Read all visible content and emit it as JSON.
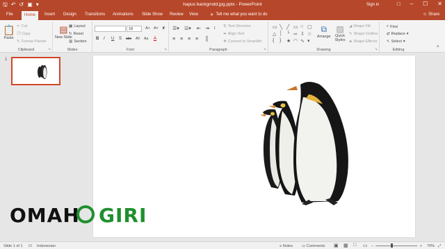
{
  "colors": {
    "accent": "#b7472a",
    "active_slide_border": "#d24726"
  },
  "window": {
    "title": "hapus backgrndd.jpg.pptx  -  PowerPoint",
    "signin": "Sign in",
    "qat_icons": [
      "save-icon",
      "undo-icon",
      "redo-icon",
      "start-slideshow-icon",
      "customize-qat-icon"
    ],
    "controls": [
      "ribbon-display-icon",
      "minimize-icon",
      "maximize-icon",
      "close-icon"
    ]
  },
  "tabs": [
    "File",
    "Home",
    "Insert",
    "Design",
    "Transitions",
    "Animations",
    "Slide Show",
    "Review",
    "View"
  ],
  "tellme": "Tell me what you want to do",
  "share": "Share",
  "ribbon": {
    "clipboard": {
      "label": "Clipboard",
      "paste": "Paste",
      "cut": "Cut",
      "copy": "Copy",
      "format_painter": "Format Painter"
    },
    "slides": {
      "label": "Slides",
      "new_slide": "New Slide",
      "layout": "Layout",
      "reset": "Reset",
      "section": "Section"
    },
    "font": {
      "label": "Font",
      "font_size": "18",
      "buttons": [
        "B",
        "I",
        "U",
        "S",
        "abc",
        "AV",
        "Aa",
        "A"
      ]
    },
    "paragraph": {
      "label": "Paragraph",
      "text_direction": "Text Direction",
      "align_text": "Align Text",
      "convert_smartart": "Convert to SmartArt"
    },
    "drawing": {
      "label": "Drawing",
      "arrange": "Arrange",
      "quick_styles": "Quick Styles",
      "shape_fill": "Shape Fill",
      "shape_outline": "Shape Outline",
      "shape_effects": "Shape Effects"
    },
    "editing": {
      "label": "Editing",
      "find": "Find",
      "replace": "Replace",
      "select": "Select"
    }
  },
  "thumbs": {
    "number": "1"
  },
  "slide": {
    "watermark_left": "OMAH",
    "watermark_right": "GIRI"
  },
  "status": {
    "slide_count": "Slide 1 of 1",
    "language": "Indonesian",
    "notes": "Notes",
    "comments": "Comments",
    "zoom": "79%",
    "zoom_level": 0.79
  }
}
